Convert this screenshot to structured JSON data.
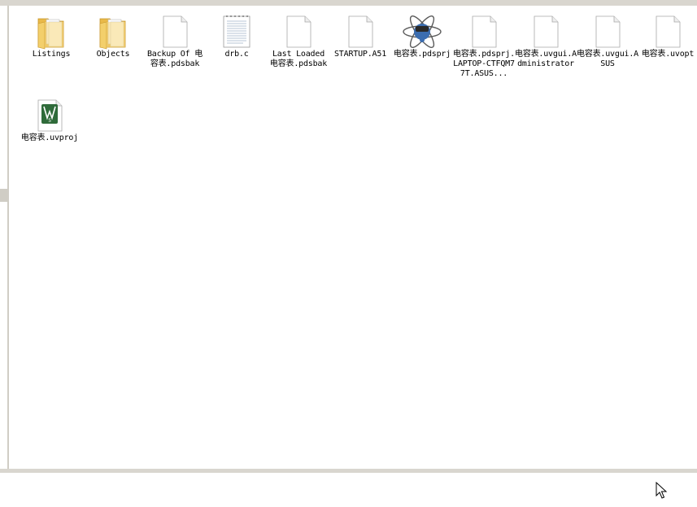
{
  "files": [
    {
      "name": "Listings",
      "icon": "folder-icon"
    },
    {
      "name": "Objects",
      "icon": "folder-icon"
    },
    {
      "name": "Backup Of 电容表.pdsbak",
      "icon": "file-icon"
    },
    {
      "name": "drb.c",
      "icon": "text-file-icon"
    },
    {
      "name": "Last Loaded 电容表.pdsbak",
      "icon": "file-icon"
    },
    {
      "name": "STARTUP.A51",
      "icon": "file-icon"
    },
    {
      "name": "电容表.pdsprj",
      "icon": "proteus-project-icon"
    },
    {
      "name": "电容表.pdsprj.LAPTOP-CTFQM77T.ASUS...",
      "icon": "file-icon"
    },
    {
      "name": "电容表.uvgui.Administrator",
      "icon": "file-icon"
    },
    {
      "name": "电容表.uvgui.ASUS",
      "icon": "file-icon"
    },
    {
      "name": "电容表.uvopt",
      "icon": "file-icon"
    },
    {
      "name": "电容表.uvproj",
      "icon": "keil-project-icon"
    }
  ],
  "colors": {
    "chrome": "#d9d6cf",
    "folder": "#f3cf6b",
    "keil_green": "#2f6b3a"
  }
}
